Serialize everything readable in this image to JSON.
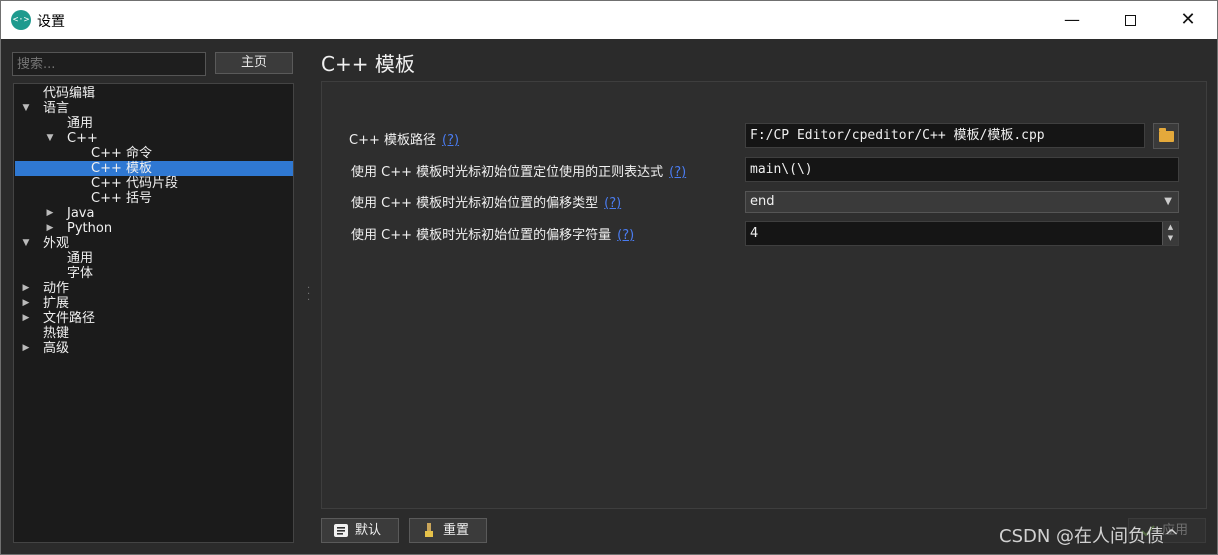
{
  "window": {
    "title": "设置"
  },
  "sidebar": {
    "search_placeholder": "搜索...",
    "home_button": "主页",
    "tree": [
      {
        "label": "代码编辑",
        "level": 0,
        "arrow": ""
      },
      {
        "label": "语言",
        "level": 0,
        "arrow": "expanded"
      },
      {
        "label": "通用",
        "level": 1,
        "arrow": ""
      },
      {
        "label": "C++",
        "level": 1,
        "arrow": "expanded"
      },
      {
        "label": "C++ 命令",
        "level": 2,
        "arrow": ""
      },
      {
        "label": "C++ 模板",
        "level": 2,
        "arrow": "",
        "selected": true
      },
      {
        "label": "C++ 代码片段",
        "level": 2,
        "arrow": ""
      },
      {
        "label": "C++ 括号",
        "level": 2,
        "arrow": ""
      },
      {
        "label": "Java",
        "level": 1,
        "arrow": "collapsed"
      },
      {
        "label": "Python",
        "level": 1,
        "arrow": "collapsed"
      },
      {
        "label": "外观",
        "level": 0,
        "arrow": "expanded"
      },
      {
        "label": "通用",
        "level": 1,
        "arrow": ""
      },
      {
        "label": "字体",
        "level": 1,
        "arrow": ""
      },
      {
        "label": "动作",
        "level": 0,
        "arrow": "collapsed"
      },
      {
        "label": "扩展",
        "level": 0,
        "arrow": "collapsed"
      },
      {
        "label": "文件路径",
        "level": 0,
        "arrow": "collapsed"
      },
      {
        "label": "热键",
        "level": 0,
        "arrow": ""
      },
      {
        "label": "高级",
        "level": 0,
        "arrow": "collapsed"
      }
    ]
  },
  "main": {
    "title": "C++ 模板",
    "settings": [
      {
        "label": "C++ 模板路径",
        "help": "(?)",
        "value": "F:/CP Editor/cpeditor/C++ 模板/模板.cpp",
        "kind": "path"
      },
      {
        "label": "使用 C++ 模板时光标初始位置定位使用的正则表达式",
        "help": "(?)",
        "value": "main\\(\\)",
        "kind": "text"
      },
      {
        "label": "使用 C++ 模板时光标初始位置的偏移类型",
        "help": "(?)",
        "value": "end",
        "kind": "combo"
      },
      {
        "label": "使用 C++ 模板时光标初始位置的偏移字符量",
        "help": "(?)",
        "value": "4",
        "kind": "spin"
      }
    ]
  },
  "footer": {
    "default_button": "默认",
    "reset_button": "重置",
    "apply_button": "应用"
  },
  "watermark": "CSDN @在人间负债^",
  "colors": {
    "selection": "#2f78d2",
    "help_link": "#4a7cf0",
    "folder": "#e4a93b",
    "app_icon": "#1e9a8e"
  }
}
